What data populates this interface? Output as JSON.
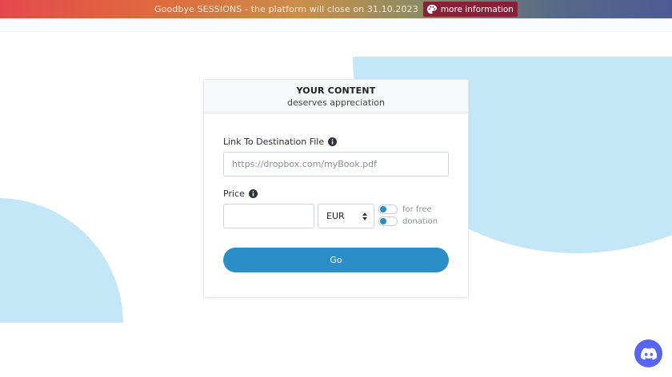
{
  "banner": {
    "text": "Goodbye SESSIONS - the platform will close on 31.10.2023",
    "button_label": "more information",
    "button_icon": "palette-icon"
  },
  "card": {
    "title": "YOUR CONTENT",
    "subtitle": "deserves appreciation",
    "link_field": {
      "label": "Link To Destination File",
      "placeholder": "https://dropbox.com/myBook.pdf",
      "value": ""
    },
    "price_field": {
      "label": "Price",
      "value": ""
    },
    "currency": {
      "selected": "EUR"
    },
    "options": [
      {
        "label": "for free",
        "on": false
      },
      {
        "label": "donation",
        "on": false
      }
    ],
    "submit_label": "Go"
  },
  "colors": {
    "accent": "#2c8ec6",
    "background_shape": "#c4e7f7",
    "banner_button": "#8a1f38",
    "discord": "#5865f2"
  },
  "floating": {
    "icon": "discord-icon"
  }
}
